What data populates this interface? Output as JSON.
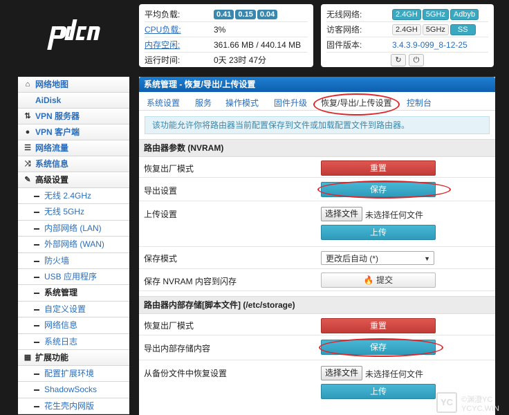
{
  "logo": "pdcn",
  "status": {
    "load_label": "平均负载:",
    "load_values": [
      "0.41",
      "0.15",
      "0.04"
    ],
    "cpu_label": "CPU负载:",
    "cpu_value": "3%",
    "mem_label": "内存空闲:",
    "mem_value": "361.66 MB / 440.14 MB",
    "uptime_label": "运行时间:",
    "uptime_value": "0天 23时 47分"
  },
  "network": {
    "wireless_label": "无线网络:",
    "wireless_badges": [
      "2.4GH",
      "5GHz",
      "Adbyb"
    ],
    "guest_label": "访客网络:",
    "guest_badges": [
      "2.4GH",
      "5GHz",
      "SS"
    ],
    "firmware_label": "固件版本:",
    "firmware_value": "3.4.3.9-099_8-12-25",
    "icons": [
      "refresh-icon",
      "power-icon"
    ]
  },
  "sidebar": {
    "items": [
      {
        "label": "网络地图",
        "icon": "home-icon"
      },
      {
        "label": "AiDisk",
        "icon": ""
      },
      {
        "label": "VPN 服务器",
        "icon": "arrows-icon"
      },
      {
        "label": "VPN 客户端",
        "icon": "globe-icon"
      },
      {
        "label": "网络流量",
        "icon": "list-icon"
      },
      {
        "label": "系统信息",
        "icon": "shuffle-icon"
      },
      {
        "label": "高级设置",
        "icon": "wrench-icon"
      }
    ],
    "subitems": [
      "无线 2.4GHz",
      "无线 5GHz",
      "内部网络 (LAN)",
      "外部网络 (WAN)",
      "防火墙",
      "USB 应用程序",
      "系统管理",
      "自定义设置",
      "网络信息",
      "系统日志"
    ],
    "ext_label": "扩展功能",
    "ext_subitems": [
      "配置扩展环境",
      "ShadowSocks",
      "花生壳内网版"
    ]
  },
  "main": {
    "title": "系统管理 - 恢复/导出/上传设置",
    "tabs": [
      "系统设置",
      "服务",
      "操作模式",
      "固件升级",
      "恢复/导出/上传设置",
      "控制台"
    ],
    "info": "该功能允许你将路由器当前配置保存到文件或加载配置文件到路由器。",
    "nvram_section": "路由器参数 (NVRAM)",
    "nvram_rows": {
      "factory_label": "恢复出厂模式",
      "factory_btn": "重置",
      "export_label": "导出设置",
      "export_btn": "保存",
      "upload_label": "上传设置",
      "choose_file": "选择文件",
      "no_file": "未选择任何文件",
      "upload_btn": "上传",
      "save_mode_label": "保存模式",
      "save_mode_value": "更改后自动 (*)",
      "flash_label": "保存 NVRAM 内容到闪存",
      "flash_btn": "提交"
    },
    "storage_section": "路由器内部存储[脚本文件] (/etc/storage)",
    "storage_rows": {
      "factory_label": "恢复出厂模式",
      "factory_btn": "重置",
      "export_label": "导出内部存储内容",
      "export_btn": "保存",
      "restore_label": "从备份文件中恢复设置",
      "choose_file": "选择文件",
      "no_file": "未选择任何文件",
      "upload_btn": "上传"
    }
  },
  "watermark": {
    "box": "YC",
    "line1": "©渊澄YC",
    "line2": "YCYC.WIN"
  },
  "colors": {
    "title_blue": "#1577c8",
    "btn_red": "#d2463f",
    "btn_blue": "#3aa8c8",
    "annotation_red": "#e0252a"
  }
}
